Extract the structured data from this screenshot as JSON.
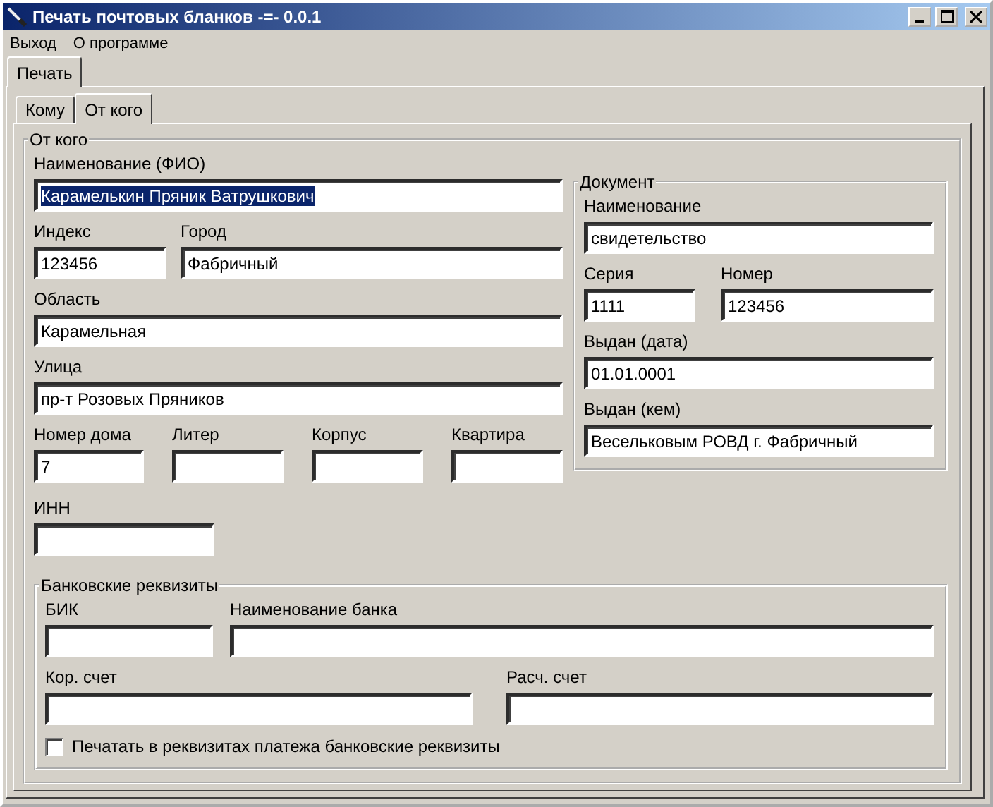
{
  "window": {
    "title": "Печать почтовых бланков -=- 0.0.1"
  },
  "menu": [
    "Выход",
    "О программе"
  ],
  "outer_tabs": [
    {
      "label": "Печать",
      "selected": true
    }
  ],
  "inner_tabs": [
    {
      "label": "Кому",
      "selected": false
    },
    {
      "label": "От кого",
      "selected": true
    }
  ],
  "sender": {
    "title": "От кого",
    "rows": [
      [
        {
          "label": "Наименование (ФИО)",
          "value": "Карамелькин Пряник Ватрушкович",
          "text_selected": true
        }
      ],
      [
        {
          "label": "Индекс",
          "value": "123456"
        },
        {
          "label": "Город",
          "value": "Фабричный"
        }
      ],
      [
        {
          "label": "Область",
          "value": "Карамельная"
        }
      ],
      [
        {
          "label": "Улица",
          "value": "пр-т Розовых Пряников"
        }
      ],
      [
        {
          "label": "Номер дома",
          "value": "7"
        },
        {
          "label": "Литер"
        },
        {
          "label": "Корпус"
        },
        {
          "label": "Квартира"
        }
      ],
      [
        {
          "label": "ИНН"
        }
      ]
    ]
  },
  "document": {
    "title": "Документ",
    "rows": [
      [
        {
          "label": "Наименование",
          "value": "свидетельство"
        }
      ],
      [
        {
          "label": "Серия",
          "value": "1111"
        },
        {
          "label": "Номер",
          "value": "123456"
        }
      ],
      [
        {
          "label": "Выдан (дата)",
          "value": "01.01.0001"
        }
      ],
      [
        {
          "label": "Выдан (кем)",
          "value": "Весельковым РОВД г. Фабричный"
        }
      ]
    ]
  },
  "bank": {
    "title": "Банковские реквизиты",
    "rows": [
      [
        {
          "label": "БИК"
        },
        {
          "label": "Наименование банка"
        }
      ],
      [
        {
          "label": "Кор. счет"
        },
        {
          "label": "Расч. счет"
        }
      ]
    ],
    "checkbox": {
      "label": "Печатать в реквизитах платежа банковские реквизиты",
      "checked": false
    }
  }
}
